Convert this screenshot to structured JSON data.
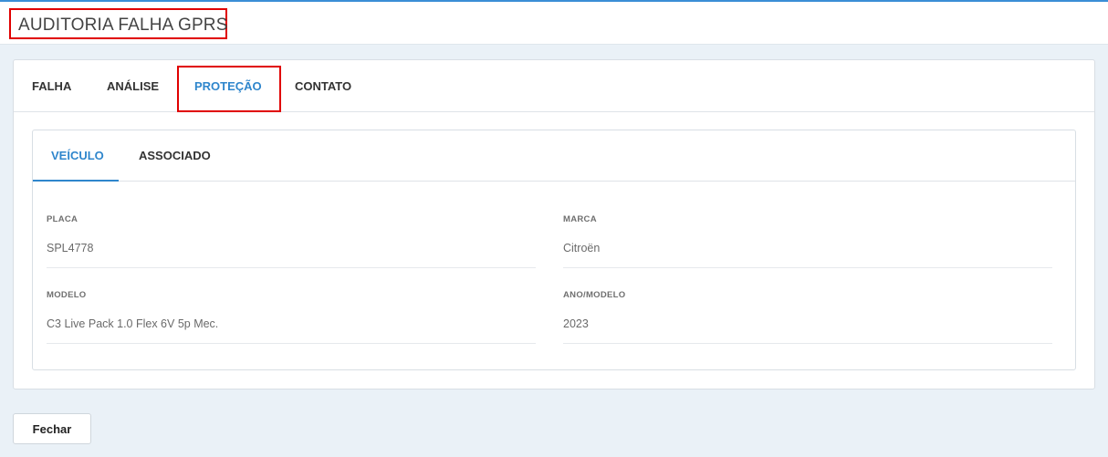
{
  "header": {
    "title": "AUDITORIA FALHA GPRS"
  },
  "tabs": [
    {
      "label": "FALHA",
      "active": false
    },
    {
      "label": "ANÁLISE",
      "active": false
    },
    {
      "label": "PROTEÇÃO",
      "active": true
    },
    {
      "label": "CONTATO",
      "active": false
    }
  ],
  "subtabs": [
    {
      "label": "VEÍCULO",
      "active": true
    },
    {
      "label": "ASSOCIADO",
      "active": false
    }
  ],
  "vehicle": {
    "placa": {
      "label": "PLACA",
      "value": "SPL4778"
    },
    "marca": {
      "label": "MARCA",
      "value": "Citroën"
    },
    "modelo": {
      "label": "MODELO",
      "value": "C3 Live Pack 1.0 Flex 6V 5p Mec."
    },
    "ano_modelo": {
      "label": "ANO/MODELO",
      "value": "2023"
    }
  },
  "footer": {
    "close_label": "Fechar"
  },
  "colors": {
    "accent": "#2f86cc",
    "highlight": "#e00000",
    "background": "#eaf1f7"
  }
}
